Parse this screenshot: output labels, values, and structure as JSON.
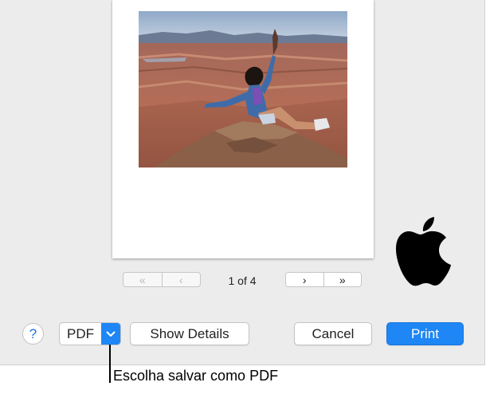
{
  "pagination": {
    "indicator": "1 of 4",
    "first_label": "«",
    "prev_label": "‹",
    "next_label": "›",
    "last_label": "»"
  },
  "toolbar": {
    "help_label": "?",
    "pdf_label": "PDF",
    "pdf_arrow_icon": "chevron-down-icon",
    "details_label": "Show Details",
    "cancel_label": "Cancel",
    "print_label": "Print"
  },
  "callout": {
    "text": "Escolha salvar como PDF"
  },
  "colors": {
    "accent": "#1e86f5",
    "dialog_bg": "#ececec"
  }
}
